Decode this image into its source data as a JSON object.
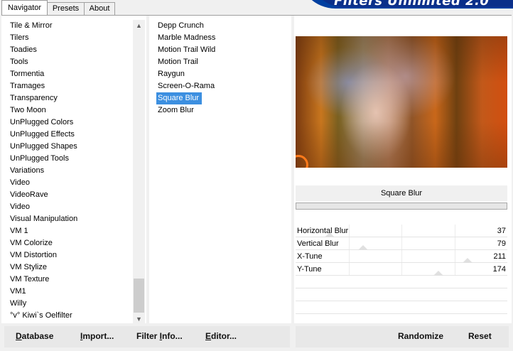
{
  "tabs": [
    {
      "label": "Navigator",
      "active": true
    },
    {
      "label": "Presets",
      "active": false
    },
    {
      "label": "About",
      "active": false
    }
  ],
  "banner": {
    "title": "Filters Unlimited 2.0"
  },
  "categories": [
    "Tile & Mirror",
    "Tilers",
    "Toadies",
    "Tools",
    "Tormentia",
    "Tramages",
    "Transparency",
    "Two Moon",
    "UnPlugged Colors",
    "UnPlugged Effects",
    "UnPlugged Shapes",
    "UnPlugged Tools",
    "Variations",
    "Video",
    "VideoRave",
    "Video",
    "Visual Manipulation",
    "VM 1",
    "VM Colorize",
    "VM Distortion",
    "VM Stylize",
    "VM Texture",
    "VM1",
    "Willy",
    "°v° Kiwi`s Oelfilter"
  ],
  "scrollbar": {
    "up_icon": "▲",
    "down_icon": "▼"
  },
  "filters": [
    "Depp Crunch",
    "Marble Madness",
    "Motion Trail Wild",
    "Motion Trail",
    "Raygun",
    "Screen-O-Rama",
    "Square Blur",
    "Zoom Blur"
  ],
  "selected_filter": "Square Blur",
  "filter_title": "Square Blur",
  "params": [
    {
      "label": "Horizontal Blur",
      "value": "37",
      "level": 37
    },
    {
      "label": "Vertical Blur",
      "value": "79",
      "level": 79
    },
    {
      "label": "X-Tune",
      "value": "211",
      "level": 211
    },
    {
      "label": "Y-Tune",
      "value": "174",
      "level": 174
    }
  ],
  "param_max": 255,
  "buttons": {
    "database": {
      "key": "D",
      "rest": "atabase"
    },
    "import": {
      "key": "I",
      "rest": "mport..."
    },
    "filter_info": {
      "pre": "Filter ",
      "key": "I",
      "rest": "nfo..."
    },
    "editor": {
      "key": "E",
      "rest": "ditor..."
    },
    "randomize": "Randomize",
    "reset": "Reset"
  },
  "colors": {
    "selection": "#3c8fe0",
    "banner": "#0a2f8a"
  }
}
